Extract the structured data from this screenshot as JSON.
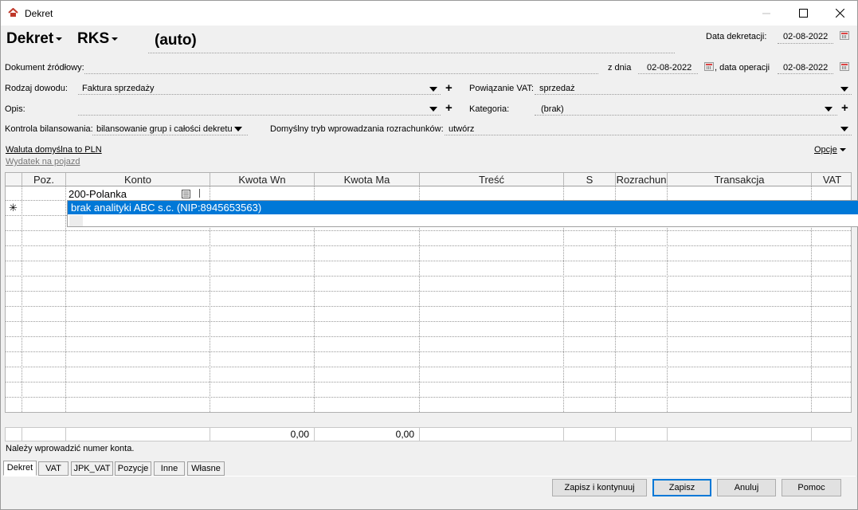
{
  "window": {
    "title": "Dekret"
  },
  "header": {
    "type_label": "Dekret",
    "journal_label": "RKS",
    "number": "(auto)",
    "posting_date_label": "Data dekretacji:",
    "posting_date": "02-08-2022"
  },
  "source_doc": {
    "label": "Dokument źródłowy:",
    "value": "",
    "date_label": "z dnia",
    "date": "02-08-2022",
    "op_date_label": ", data operacji",
    "op_date": "02-08-2022"
  },
  "proof_type": {
    "label": "Rodzaj dowodu:",
    "value": "Faktura sprzedaży"
  },
  "vat_link": {
    "label": "Powiązanie VAT:",
    "value": "sprzedaż"
  },
  "description": {
    "label": "Opis:",
    "value": ""
  },
  "category": {
    "label": "Kategoria:",
    "value": "(brak)"
  },
  "balance_control": {
    "label": "Kontrola bilansowania:",
    "value": "bilansowanie grup i całości dekretu"
  },
  "settlement_mode": {
    "label": "Domyślny tryb wprowadzania rozrachunków:",
    "value": "utwórz"
  },
  "links": {
    "currency": "Waluta domyślna to PLN",
    "vehicle": "Wydatek na pojazd",
    "options": "Opcje"
  },
  "grid": {
    "columns": [
      "Poz.",
      "Konto",
      "Kwota Wn",
      "Kwota Ma",
      "Treść",
      "S",
      "Rozrachun",
      "Transakcja",
      "VAT"
    ],
    "editing_value": "200-Polanka",
    "new_row_marker": "✳",
    "suggestion": "brak analityki ABC s.c.  (NIP:8945653563)"
  },
  "totals": {
    "wn": "0,00",
    "ma": "0,00"
  },
  "status_text": "Należy wprowadzić numer konta.",
  "tabs": [
    "Dekret",
    "VAT",
    "JPK_VAT",
    "Pozycje",
    "Inne",
    "Własne"
  ],
  "buttons": {
    "save_continue": "Zapisz i kontynuuj",
    "save": "Zapisz",
    "cancel": "Anuluj",
    "help": "Pomoc"
  },
  "icons": [
    "app-icon",
    "minimize-icon",
    "maximize-icon",
    "close-icon",
    "calendar-icon",
    "plus-icon",
    "dropdown-arrow-icon",
    "lookup-icon"
  ]
}
